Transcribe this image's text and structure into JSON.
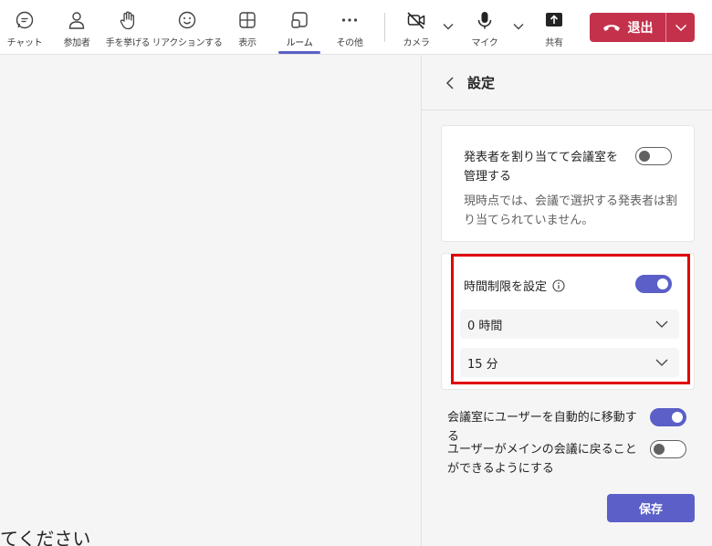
{
  "toolbar": {
    "chat": "チャット",
    "people": "参加者",
    "raise_hand": "手を挙げる",
    "reactions": "リアクションする",
    "view": "表示",
    "rooms": "ルーム",
    "more": "その他",
    "camera": "カメラ",
    "mic": "マイク",
    "share": "共有",
    "leave": "退出"
  },
  "stage": {
    "partial_text": "てください"
  },
  "settings": {
    "title": "設定",
    "assign_presenters": {
      "label": "発表者を割り当てて会議室を管理する",
      "description": "現時点では、会議で選択する発表者は割り当てられていません。",
      "enabled": false
    },
    "time_limit": {
      "label": "時間制限を設定",
      "enabled": true,
      "hours_value": "0 時間",
      "minutes_value": "15 分"
    },
    "auto_move": {
      "label": "会議室にユーザーを自動的に移動する",
      "enabled": true
    },
    "return_main": {
      "label": "ユーザーがメインの会議に戻ることができるようにする",
      "enabled": false
    },
    "save_label": "保存"
  },
  "colors": {
    "accent": "#5b5fc7",
    "leave": "#c4314b",
    "highlight": "#e00000"
  }
}
